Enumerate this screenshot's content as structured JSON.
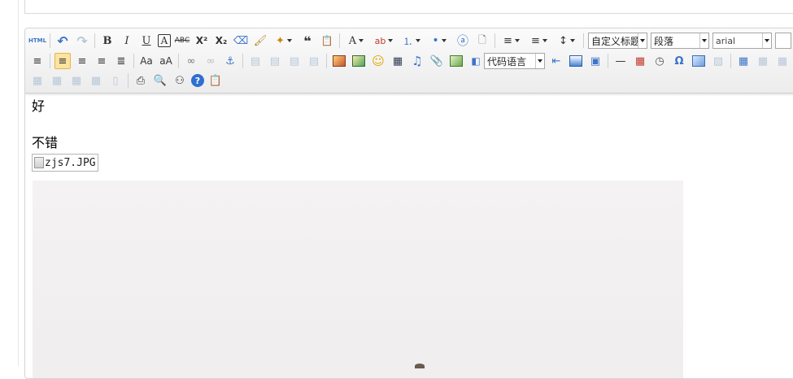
{
  "toolbar": {
    "row1": [
      {
        "name": "source-html-button",
        "glyph": "HTML"
      },
      {
        "name": "undo-button",
        "glyph": "↶"
      },
      {
        "name": "redo-button",
        "glyph": "↷"
      },
      {
        "name": "bold-button",
        "glyph": "B"
      },
      {
        "name": "italic-button",
        "glyph": "I"
      },
      {
        "name": "underline-button",
        "glyph": "U"
      },
      {
        "name": "font-border-button",
        "glyph": "A"
      },
      {
        "name": "strikethrough-button",
        "glyph": "ABC"
      },
      {
        "name": "superscript-button",
        "glyph": "X²"
      },
      {
        "name": "subscript-button",
        "glyph": "X₂"
      },
      {
        "name": "eraser-button",
        "glyph": "⌫"
      },
      {
        "name": "format-match-button",
        "glyph": "🖌"
      },
      {
        "name": "auto-typeset-button",
        "glyph": "✦"
      },
      {
        "name": "blockquote-button",
        "glyph": "❝"
      },
      {
        "name": "paste-plain-button",
        "glyph": "📋"
      },
      {
        "name": "forecolor-button",
        "glyph": "A"
      },
      {
        "name": "backcolor-button",
        "glyph": "ab"
      },
      {
        "name": "ordered-list-button",
        "glyph": "⒈"
      },
      {
        "name": "unordered-list-button",
        "glyph": "•"
      },
      {
        "name": "select-all-button",
        "glyph": "ⓐ"
      },
      {
        "name": "clear-doc-button",
        "glyph": "🗋"
      },
      {
        "name": "row-spacing-top-button",
        "glyph": "≡"
      },
      {
        "name": "row-spacing-bottom-button",
        "glyph": "≡"
      },
      {
        "name": "line-height-button",
        "glyph": "↕"
      }
    ],
    "custom_style": "自定义标题",
    "paragraph": "段落",
    "font_family": "arial",
    "code_language": "代码语言"
  },
  "content": {
    "line1": "好",
    "line2": "不错",
    "image_alt": "zjs7.JPG"
  }
}
